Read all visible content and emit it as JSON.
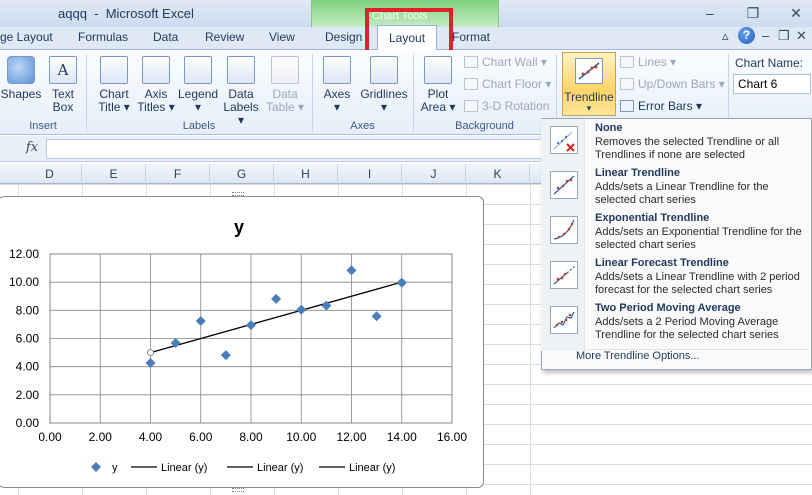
{
  "window": {
    "title": "aqqq  -  Microsoft Excel",
    "context_group": "Chart Tools",
    "controls": [
      "–",
      "❐",
      "✕"
    ]
  },
  "tabs": [
    {
      "label": "ge Layout"
    },
    {
      "label": "Formulas"
    },
    {
      "label": "Data"
    },
    {
      "label": "Review"
    },
    {
      "label": "View"
    },
    {
      "label": "Design"
    },
    {
      "label": "Layout"
    },
    {
      "label": "Format"
    }
  ],
  "help_label": "?",
  "ribbon_controls": [
    "▵",
    "–",
    "❐",
    "✕"
  ],
  "ribbon": {
    "insert": {
      "label": "Insert",
      "buttons": [
        {
          "label": "Shapes"
        },
        {
          "label": "Text Box"
        }
      ]
    },
    "labels": {
      "label": "Labels",
      "buttons": [
        {
          "line1": "Chart",
          "line2": "Title ▾"
        },
        {
          "line1": "Axis",
          "line2": "Titles ▾"
        },
        {
          "line1": "Legend",
          "line2": "▾"
        },
        {
          "line1": "Data",
          "line2": "Labels ▾"
        },
        {
          "line1": "Data",
          "line2": "Table ▾"
        }
      ]
    },
    "axes": {
      "label": "Axes",
      "buttons": [
        {
          "line1": "Axes",
          "line2": "▾"
        },
        {
          "line1": "Gridlines",
          "line2": "▾"
        }
      ]
    },
    "background": {
      "label": "Background",
      "plot_area": {
        "line1": "Plot",
        "line2": "Area ▾"
      },
      "small": [
        "Chart Wall ▾",
        "Chart Floor ▾",
        "3-D Rotation"
      ]
    },
    "analysis": {
      "trendline": "Trendline",
      "trendline_arrow": "▾",
      "small": [
        "Lines ▾",
        "Up/Down Bars ▾",
        "Error Bars ▾"
      ]
    },
    "chart_name": {
      "label": "Chart Name:",
      "value": "Chart 6"
    }
  },
  "formula_bar": {
    "fx": "fx",
    "value": ""
  },
  "columns": [
    "D",
    "E",
    "F",
    "G",
    "H",
    "I",
    "J",
    "K"
  ],
  "trendline_menu": {
    "items": [
      {
        "title": "None",
        "desc": "Removes the selected Trendline or all Trendlines if none are selected",
        "icon": "trendline-none-icon"
      },
      {
        "title": "Linear Trendline",
        "desc": "Adds/sets a Linear Trendline for the selected chart series",
        "icon": "linear-trendline-icon"
      },
      {
        "title": "Exponential Trendline",
        "desc": "Adds/sets an Exponential Trendline for the selected chart series",
        "icon": "exponential-trendline-icon"
      },
      {
        "title": "Linear Forecast Trendline",
        "desc": "Adds/sets a Linear Trendline with 2 period forecast for the selected chart series",
        "icon": "linear-forecast-icon"
      },
      {
        "title": "Two Period Moving Average",
        "desc": "Adds/sets a 2 Period Moving Average Trendline for the selected chart series",
        "icon": "moving-average-icon"
      }
    ],
    "more": "More Trendline Options..."
  },
  "chart_data": {
    "type": "scatter",
    "title": "y",
    "xlim": [
      0,
      16
    ],
    "ylim": [
      0,
      12
    ],
    "xticks": [
      "0.00",
      "2.00",
      "4.00",
      "6.00",
      "8.00",
      "10.00",
      "12.00",
      "14.00",
      "16.00"
    ],
    "yticks": [
      "0.00",
      "2.00",
      "4.00",
      "6.00",
      "8.00",
      "10.00",
      "12.00"
    ],
    "grid": true,
    "legend_position": "bottom",
    "series": [
      {
        "name": "y",
        "marker": "diamond",
        "color": "#4a7ebb",
        "x": [
          4,
          5,
          6,
          7,
          8,
          9,
          10,
          11,
          12,
          13,
          14
        ],
        "y": [
          4.26,
          5.68,
          7.24,
          4.82,
          6.95,
          8.81,
          8.04,
          8.33,
          10.84,
          7.58,
          9.96
        ]
      }
    ],
    "trendline": {
      "x": [
        4,
        14
      ],
      "y": [
        5.0,
        10.0
      ],
      "color": "#000000"
    },
    "legend": [
      "y",
      "Linear (y)",
      "Linear (y)",
      "Linear (y)"
    ]
  }
}
